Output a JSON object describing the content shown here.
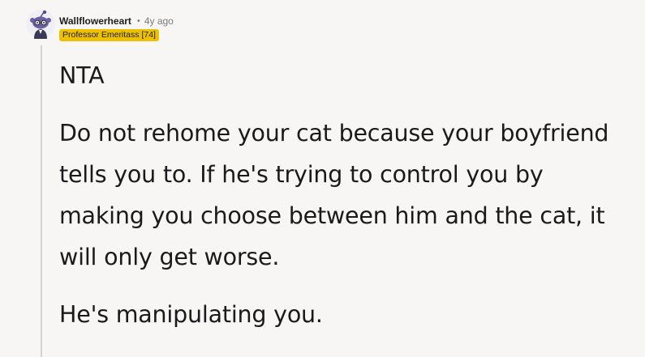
{
  "comment": {
    "author": "Wallflowerheart",
    "separator": "•",
    "time": "4y ago",
    "flair": "Professor Emeritass [74]",
    "flair_color": "#edc100",
    "avatar_icon": "snoo-avatar-icon",
    "paragraphs": [
      "NTA",
      "Do not rehome your cat because your boyfriend tells you to. If he's trying to control you by making you choose between him and the cat, it will only get worse.",
      "He's manipulating you."
    ]
  }
}
